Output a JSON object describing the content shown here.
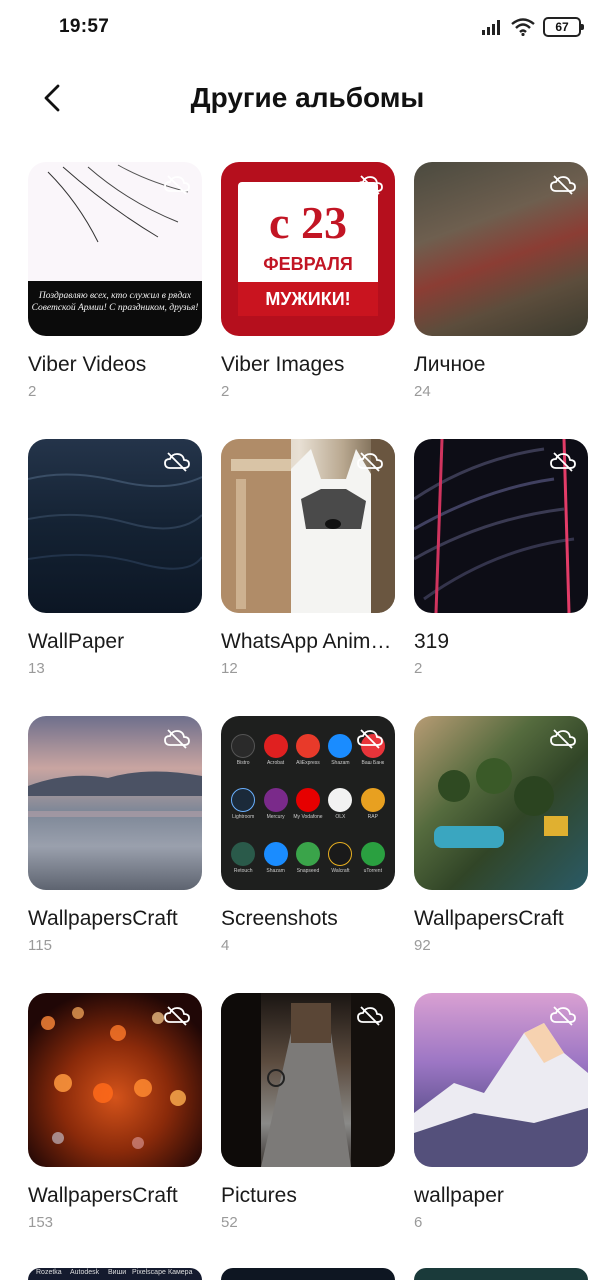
{
  "status_bar": {
    "time": "19:57",
    "battery": "67",
    "icons": [
      "signal-icon",
      "wifi-icon",
      "battery-icon"
    ]
  },
  "header": {
    "title": "Другие альбомы",
    "back_icon": "chevron-left-icon"
  },
  "albums": [
    {
      "name": "Viber Videos",
      "count": "2",
      "caption": "Поздравляю всех, кто служил в рядах Советской Армии! С праздником, друзья!"
    },
    {
      "name": "Viber Images",
      "count": "2",
      "card_line1": "с 23",
      "card_line2": "ФЕВРАЛЯ",
      "card_line3": "МУЖИКИ!"
    },
    {
      "name": "Личное",
      "count": "24"
    },
    {
      "name": "WallPaper",
      "count": "13"
    },
    {
      "name": "WhatsApp Animated Gifs",
      "count": "12"
    },
    {
      "name": "319",
      "count": "2"
    },
    {
      "name": "WallpapersCraft",
      "count": "115"
    },
    {
      "name": "Screenshots",
      "count": "4",
      "apps": [
        "Bistro",
        "Acrobat",
        "AliExpress",
        "Shazam",
        "Ваш Банк",
        "Lightroom",
        "Mercury",
        "My Vodafone",
        "OLX",
        "RAP",
        "Retouch",
        "Shazam",
        "Snapseed",
        "Walcraft",
        "uTorrent"
      ]
    },
    {
      "name": "WallpapersCraft",
      "count": "92"
    },
    {
      "name": "WallpapersCraft",
      "count": "153"
    },
    {
      "name": "Pictures",
      "count": "52"
    },
    {
      "name": "wallpaper",
      "count": "6"
    }
  ],
  "peek_row": {
    "labels": [
      "Rozetka",
      "Autodesk",
      "Виши",
      "Pixelscape",
      "Камера"
    ]
  },
  "colors": {
    "accent_red": "#b50f1d",
    "text_primary": "#1a1a1a",
    "text_secondary": "#9a9a9a"
  }
}
